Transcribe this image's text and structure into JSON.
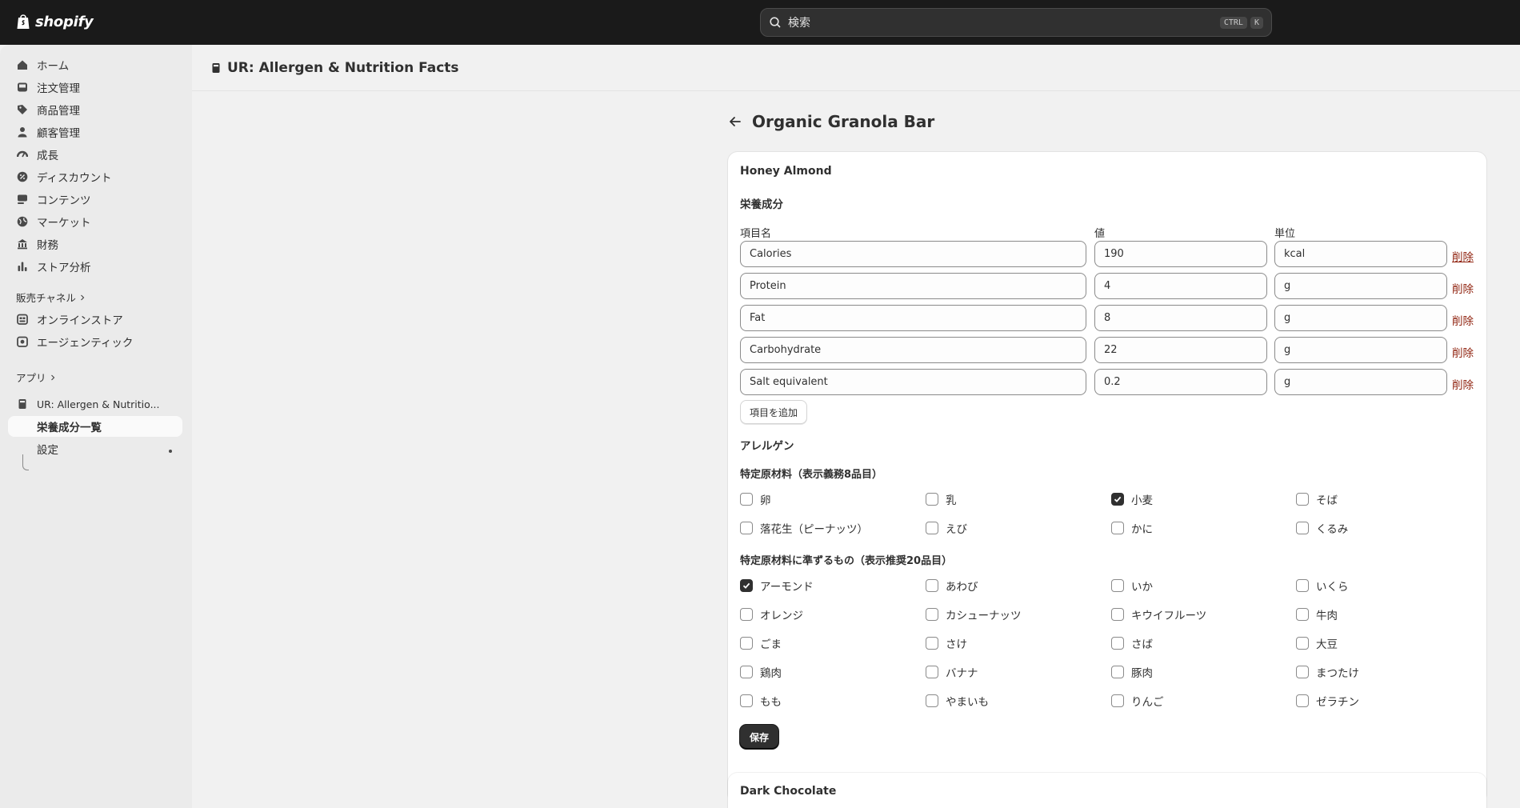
{
  "topbar": {
    "brand": "shopify",
    "search_placeholder": "検索",
    "shortcut_key1": "CTRL",
    "shortcut_key2": "K"
  },
  "sidebar": {
    "items": [
      {
        "label": "ホーム",
        "icon": "home-icon"
      },
      {
        "label": "注文管理",
        "icon": "inbox-icon"
      },
      {
        "label": "商品管理",
        "icon": "tag-icon"
      },
      {
        "label": "顧客管理",
        "icon": "person-icon"
      },
      {
        "label": "成長",
        "icon": "gauge-icon"
      },
      {
        "label": "ディスカウント",
        "icon": "discount-icon"
      },
      {
        "label": "コンテンツ",
        "icon": "content-icon"
      },
      {
        "label": "マーケット",
        "icon": "globe-icon"
      },
      {
        "label": "財務",
        "icon": "bank-icon"
      },
      {
        "label": "ストア分析",
        "icon": "bar-chart-icon"
      }
    ],
    "sales_channels_label": "販売チャネル",
    "channels": [
      {
        "label": "オンラインストア",
        "icon": "store-icon"
      },
      {
        "label": "エージェンティック",
        "icon": "agentic-icon"
      }
    ],
    "apps_label": "アプリ",
    "app_name": "UR: Allergen & Nutritio...",
    "app_sub_items": [
      {
        "label": "栄養成分一覧"
      },
      {
        "label": "設定"
      }
    ]
  },
  "app_header": {
    "title": "UR: Allergen & Nutrition Facts"
  },
  "page": {
    "title": "Organic Granola Bar"
  },
  "variant": {
    "name": "Honey Almond",
    "nutrition_heading": "栄養成分",
    "columns": {
      "name": "項目名",
      "value": "値",
      "unit": "単位"
    },
    "rows": [
      {
        "name": "Calories",
        "value": "190",
        "unit": "kcal"
      },
      {
        "name": "Protein",
        "value": "4",
        "unit": "g"
      },
      {
        "name": "Fat",
        "value": "8",
        "unit": "g"
      },
      {
        "name": "Carbohydrate",
        "value": "22",
        "unit": "g"
      },
      {
        "name": "Salt equivalent",
        "value": "0.2",
        "unit": "g"
      }
    ],
    "delete_label": "削除",
    "add_row_label": "項目を追加",
    "allergen_heading": "アレルゲン",
    "specific_heading": "特定原材料（表示義務8品目）",
    "specific": [
      {
        "label": "卵",
        "checked": false
      },
      {
        "label": "乳",
        "checked": false
      },
      {
        "label": "小麦",
        "checked": true
      },
      {
        "label": "そば",
        "checked": false
      },
      {
        "label": "落花生（ピーナッツ）",
        "checked": false
      },
      {
        "label": "えび",
        "checked": false
      },
      {
        "label": "かに",
        "checked": false
      },
      {
        "label": "くるみ",
        "checked": false
      }
    ],
    "recommended_heading": "特定原材料に準ずるもの（表示推奨20品目）",
    "recommended": [
      {
        "label": "アーモンド",
        "checked": true
      },
      {
        "label": "あわび",
        "checked": false
      },
      {
        "label": "いか",
        "checked": false
      },
      {
        "label": "いくら",
        "checked": false
      },
      {
        "label": "オレンジ",
        "checked": false
      },
      {
        "label": "カシューナッツ",
        "checked": false
      },
      {
        "label": "キウイフルーツ",
        "checked": false
      },
      {
        "label": "牛肉",
        "checked": false
      },
      {
        "label": "ごま",
        "checked": false
      },
      {
        "label": "さけ",
        "checked": false
      },
      {
        "label": "さば",
        "checked": false
      },
      {
        "label": "大豆",
        "checked": false
      },
      {
        "label": "鶏肉",
        "checked": false
      },
      {
        "label": "バナナ",
        "checked": false
      },
      {
        "label": "豚肉",
        "checked": false
      },
      {
        "label": "まつたけ",
        "checked": false
      },
      {
        "label": "もも",
        "checked": false
      },
      {
        "label": "やまいも",
        "checked": false
      },
      {
        "label": "りんご",
        "checked": false
      },
      {
        "label": "ゼラチン",
        "checked": false
      }
    ],
    "save_label": "保存"
  },
  "next_variant": {
    "name": "Dark Chocolate"
  }
}
